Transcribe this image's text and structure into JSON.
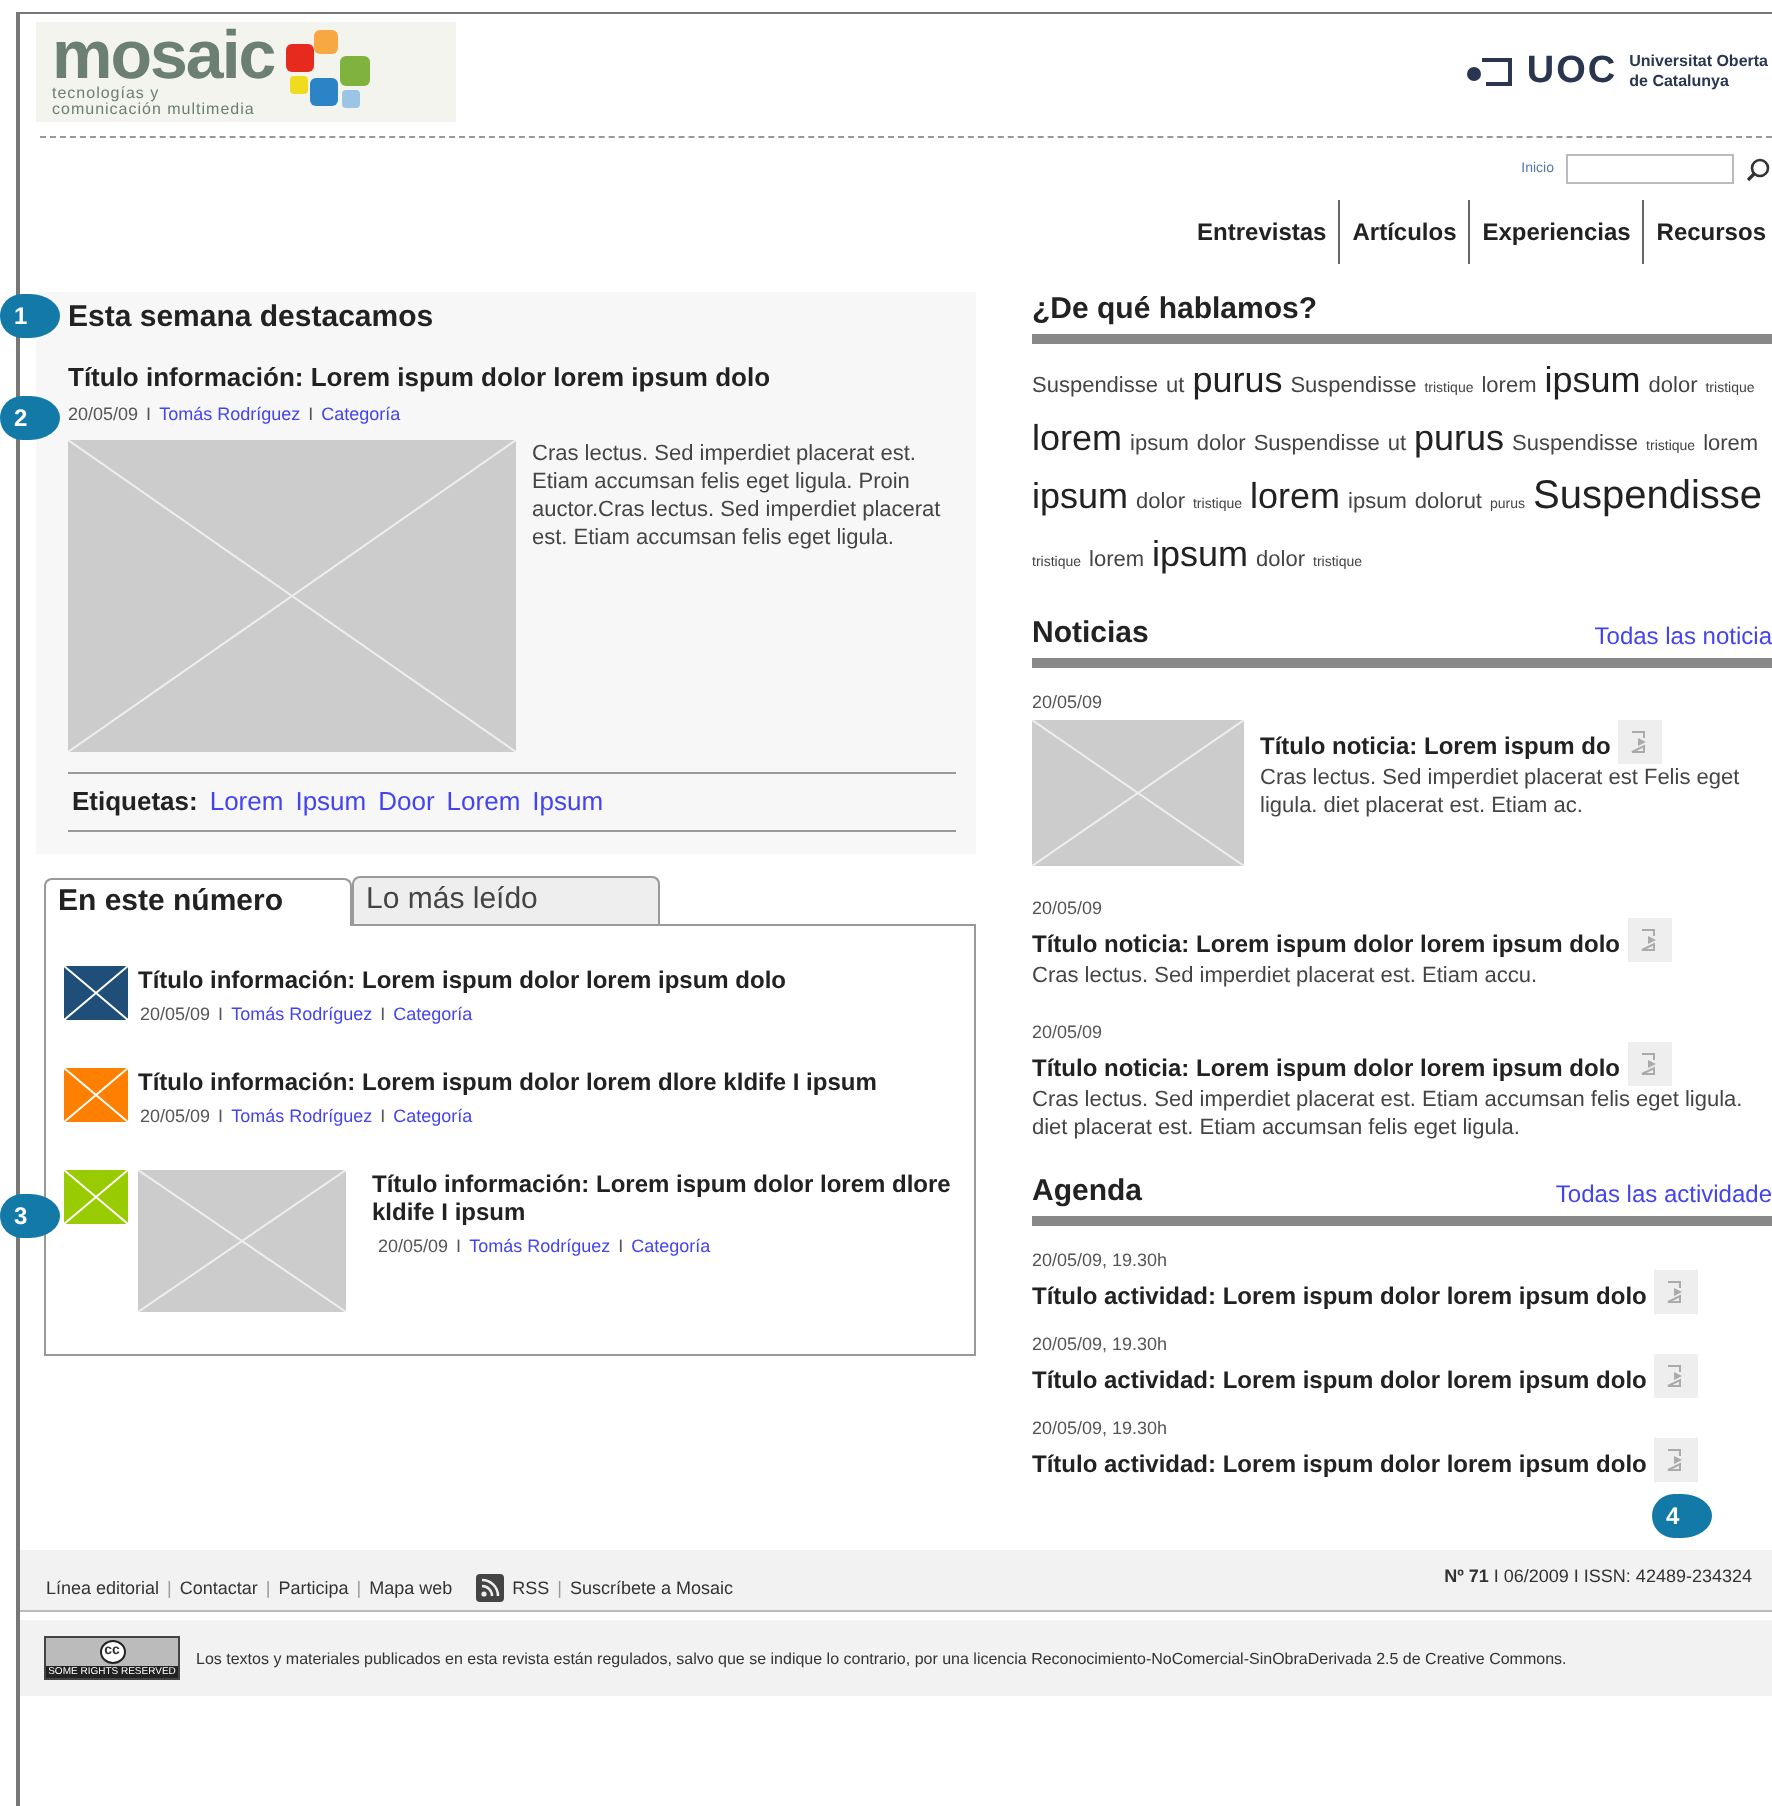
{
  "header": {
    "logo": {
      "name": "mosaic",
      "tagline_lines": [
        "tecnologías y",
        "comunicación multimedia"
      ]
    },
    "university": {
      "acronym": "UOC",
      "name_lines": [
        "Universitat Oberta",
        "de Catalunya"
      ]
    }
  },
  "search": {
    "label": "Inicio"
  },
  "nav": [
    {
      "label": "Entrevistas"
    },
    {
      "label": "Artículos"
    },
    {
      "label": "Experiencias"
    },
    {
      "label": "Recursos"
    }
  ],
  "featured": {
    "heading": "Esta semana destacamos",
    "title": "Título información: Lorem ispum dolor lorem ipsum dolo",
    "meta": [
      {
        "text": "20/05/09",
        "kind": "text"
      },
      {
        "text": "I",
        "kind": "sep"
      },
      {
        "text": "Tomás Rodríguez",
        "kind": "link"
      },
      {
        "text": "I",
        "kind": "sep"
      },
      {
        "text": "Categoría",
        "kind": "link"
      }
    ],
    "body": "Cras lectus. Sed imperdiet placerat est. Etiam accumsan felis eget ligula. Proin auctor.Cras lectus. Sed imperdiet placerat est. Etiam accumsan felis eget ligula.",
    "tags_label": "Etiquetas:",
    "tags": [
      "Lorem",
      "Ipsum",
      "Door",
      "Lorem",
      "Ipsum"
    ]
  },
  "tabs": [
    {
      "label": "En este número",
      "selected": true
    },
    {
      "label": "Lo más leído",
      "selected": false
    }
  ],
  "articles": [
    {
      "color": "#1f4e79",
      "kind": "plain",
      "title": "Título información: Lorem ispum dolor lorem ipsum dolo",
      "meta": [
        {
          "text": "20/05/09",
          "kind": "text"
        },
        {
          "text": "I",
          "kind": "sep"
        },
        {
          "text": "Tomás Rodríguez",
          "kind": "link"
        },
        {
          "text": "I",
          "kind": "sep"
        },
        {
          "text": "Categoría",
          "kind": "link"
        }
      ]
    },
    {
      "color": "#ff7f00",
      "kind": "plain",
      "title": "Título información: Lorem ispum dolor lorem dlore kldife I  ipsum",
      "meta": [
        {
          "text": "20/05/09",
          "kind": "text"
        },
        {
          "text": "I",
          "kind": "sep"
        },
        {
          "text": "Tomás Rodríguez",
          "kind": "link"
        },
        {
          "text": "I",
          "kind": "sep"
        },
        {
          "text": "Categoría",
          "kind": "link"
        }
      ]
    },
    {
      "color": "#99cc00",
      "kind": "with_image",
      "title": "Título información: Lorem ispum dolor lorem dlore kldife I  ipsum",
      "meta": [
        {
          "text": "20/05/09",
          "kind": "text"
        },
        {
          "text": "I",
          "kind": "sep"
        },
        {
          "text": "Tomás Rodríguez",
          "kind": "link"
        },
        {
          "text": "I",
          "kind": "sep"
        },
        {
          "text": "Categoría",
          "kind": "link"
        }
      ]
    }
  ],
  "topics": {
    "heading": "¿De qué hablamos?",
    "words": [
      {
        "text": "Suspendisse",
        "kind": "normal"
      },
      {
        "text": "ut",
        "kind": "normal"
      },
      {
        "text": "purus",
        "kind": "large"
      },
      {
        "text": "Suspendisse",
        "kind": "normal"
      },
      {
        "text": "tristique",
        "kind": "small"
      },
      {
        "text": "lorem",
        "kind": "normal"
      },
      {
        "text": "ipsum",
        "kind": "large"
      },
      {
        "text": "dolor",
        "kind": "normal"
      },
      {
        "text": "tristique",
        "kind": "small"
      },
      {
        "text": "lorem",
        "kind": "large"
      },
      {
        "text": "ipsum",
        "kind": "normal"
      },
      {
        "text": "dolor",
        "kind": "normal"
      },
      {
        "text": "Suspendisse",
        "kind": "normal"
      },
      {
        "text": "ut",
        "kind": "normal"
      },
      {
        "text": "purus",
        "kind": "large"
      },
      {
        "text": "Suspendisse",
        "kind": "normal"
      },
      {
        "text": "tristique",
        "kind": "small"
      },
      {
        "text": "lorem",
        "kind": "normal"
      },
      {
        "text": "ipsum",
        "kind": "large"
      },
      {
        "text": "dolor",
        "kind": "normal"
      },
      {
        "text": "tristique",
        "kind": "small"
      },
      {
        "text": "lorem",
        "kind": "large"
      },
      {
        "text": "ipsum",
        "kind": "normal"
      },
      {
        "text": "dolorut",
        "kind": "normal"
      },
      {
        "text": "purus",
        "kind": "small"
      },
      {
        "text": "Suspendisse",
        "kind": "xlarge"
      },
      {
        "text": "tristique",
        "kind": "small"
      },
      {
        "text": "lorem",
        "kind": "normal"
      },
      {
        "text": "ipsum",
        "kind": "large"
      },
      {
        "text": "dolor",
        "kind": "normal"
      },
      {
        "text": "tristique",
        "kind": "small"
      }
    ]
  },
  "news": {
    "heading": "Noticias",
    "more_link": "Todas las noticia",
    "items": [
      {
        "kind": "with_image",
        "date": "20/05/09",
        "title": "Título noticia: Lorem ispum do",
        "summary": "Cras lectus. Sed imperdiet placerat est Felis eget ligula. diet placerat est. Etiam ac."
      },
      {
        "kind": "plain",
        "date": "20/05/09",
        "title": "Título noticia: Lorem ispum dolor lorem ipsum dolo",
        "summary": "Cras lectus. Sed imperdiet placerat est. Etiam accu."
      },
      {
        "kind": "plain",
        "date": "20/05/09",
        "title": "Título noticia: Lorem ispum dolor lorem ipsum dolo",
        "summary": "Cras lectus. Sed imperdiet placerat est. Etiam accumsan felis eget ligula. diet placerat est. Etiam accumsan felis eget ligula."
      }
    ]
  },
  "agenda": {
    "heading": "Agenda",
    "more_link": "Todas las actividade",
    "items": [
      {
        "date": "20/05/09, 19.30h",
        "title": "Título actividad: Lorem ispum dolor lorem ipsum dolo"
      },
      {
        "date": "20/05/09, 19.30h",
        "title": "Título actividad: Lorem ispum dolor lorem ipsum dolo"
      },
      {
        "date": "20/05/09, 19.30h",
        "title": "Título actividad: Lorem ispum dolor lorem ipsum dolo"
      }
    ]
  },
  "footer": {
    "links": [
      {
        "text": "Línea editorial",
        "kind": "link"
      },
      {
        "text": "|",
        "kind": "sep"
      },
      {
        "text": "Contactar",
        "kind": "link"
      },
      {
        "text": "|",
        "kind": "sep"
      },
      {
        "text": "Participa",
        "kind": "link"
      },
      {
        "text": "|",
        "kind": "sep"
      },
      {
        "text": "Mapa web",
        "kind": "link"
      }
    ],
    "rss_links": [
      {
        "text": "RSS",
        "kind": "link"
      },
      {
        "text": "|",
        "kind": "sep"
      },
      {
        "text": "Suscríbete a Mosaic",
        "kind": "link"
      }
    ],
    "issue": "**Nº 71** I 06/2009  I  ISSN: 42489-234324",
    "license": {
      "badge_symbol": "cc",
      "badge_caption": "SOME RIGHTS RESERVED",
      "text": "Los textos y materiales publicados en esta revista están regulados, salvo que se indique lo contrario, por una licencia Reconocimiento-NoComercial-SinObraDerivada 2.5 de Creative Commons."
    }
  },
  "callouts": [
    {
      "label": "1"
    },
    {
      "label": "2"
    },
    {
      "label": "3"
    },
    {
      "label": "4"
    }
  ]
}
